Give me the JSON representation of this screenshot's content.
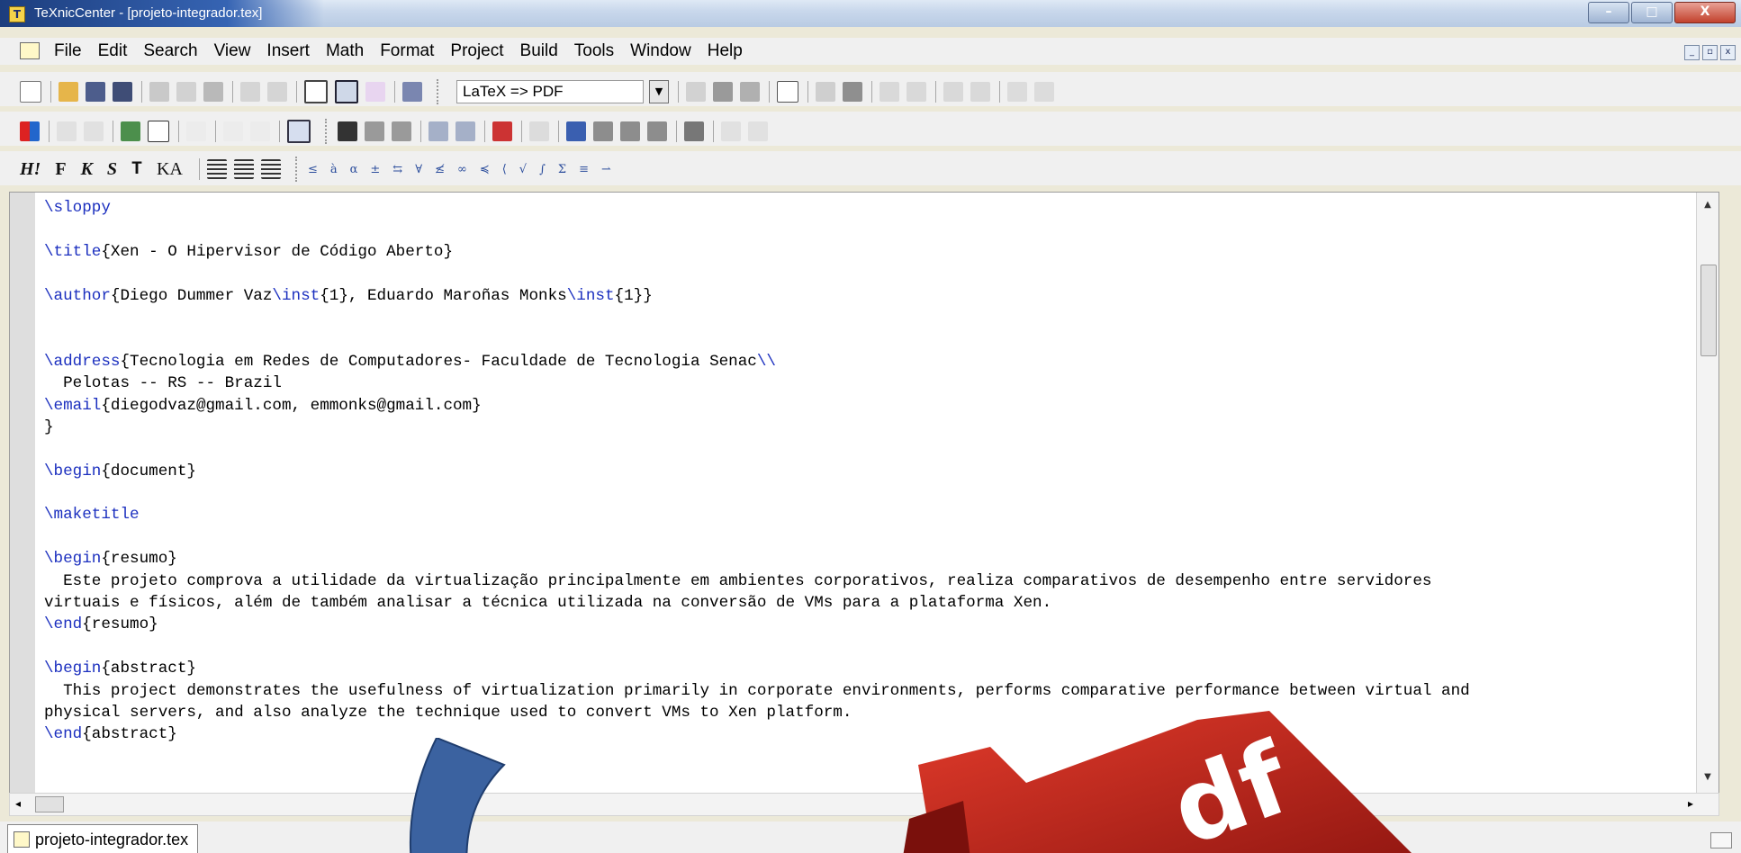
{
  "window": {
    "title": "TeXnicCenter - [projeto-integrador.tex]",
    "app_icon_letter": "T",
    "buttons": [
      "–",
      "□",
      "X"
    ]
  },
  "menubar": {
    "items": [
      "File",
      "Edit",
      "Search",
      "View",
      "Insert",
      "Math",
      "Format",
      "Project",
      "Build",
      "Tools",
      "Window",
      "Help"
    ]
  },
  "toolbar": {
    "output_profile": "LaTeX => PDF"
  },
  "format_toolbar": {
    "buttons": [
      "H!",
      "F",
      "K",
      "S",
      "T",
      "KA"
    ]
  },
  "editor": {
    "lines": [
      {
        "kw": "\\sloppy",
        "rest": ""
      },
      {
        "kw": "",
        "rest": ""
      },
      {
        "kw": "\\title",
        "rest": "{Xen - O Hipervisor de Código Aberto}"
      },
      {
        "kw": "",
        "rest": ""
      },
      {
        "kw": "\\author",
        "rest": "{Diego Dummer Vaz\\inst{1}, Eduardo Maroñas Monks\\inst{1}}"
      },
      {
        "kw": "",
        "rest": ""
      },
      {
        "kw": "",
        "rest": ""
      },
      {
        "kw": "\\address",
        "rest": "{Tecnologia em Redes de Computadores- Faculdade de Tecnologia Senac\\\\"
      },
      {
        "kw": "",
        "rest": "  Pelotas -- RS -- Brazil"
      },
      {
        "kw": "\\email",
        "rest": "{diegodvaz@gmail.com, emmonks@gmail.com}"
      },
      {
        "kw": "",
        "rest": "}"
      },
      {
        "kw": "",
        "rest": ""
      },
      {
        "kw": "\\begin",
        "rest": "{document}"
      },
      {
        "kw": "",
        "rest": ""
      },
      {
        "kw": "\\maketitle",
        "rest": ""
      },
      {
        "kw": "",
        "rest": ""
      },
      {
        "kw": "\\begin",
        "rest": "{resumo}"
      },
      {
        "kw": "",
        "rest": "  Este projeto comprova a utilidade da virtualização principalmente em ambientes corporativos, realiza comparativos de desempenho entre servidores"
      },
      {
        "kw": "",
        "rest": "virtuais e físicos, além de também analisar a técnica utilizada na conversão de VMs para a plataforma Xen."
      },
      {
        "kw": "\\end",
        "rest": "{resumo}"
      },
      {
        "kw": "",
        "rest": ""
      },
      {
        "kw": "\\begin",
        "rest": "{abstract}"
      },
      {
        "kw": "",
        "rest": "  This project demonstrates the usefulness of virtualization primarily in corporate environments, performs comparative performance between virtual and"
      },
      {
        "kw": "",
        "rest": "physical servers, and also analyze the technique used to convert VMs to Xen platform."
      },
      {
        "kw": "\\end",
        "rest": "{abstract}"
      }
    ]
  },
  "tabs": {
    "active": "projeto-integrador.tex"
  },
  "colors": {
    "keyword": "#1b2fbf",
    "overlay_blue": "#3b62a0",
    "overlay_red": "#c6281d"
  }
}
